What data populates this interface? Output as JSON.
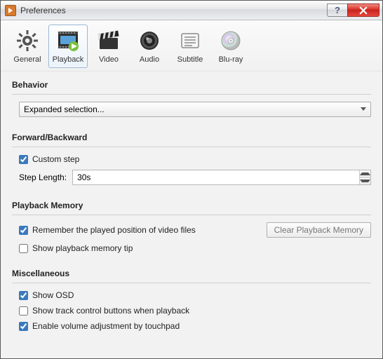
{
  "window": {
    "title": "Preferences"
  },
  "tabs": {
    "general": "General",
    "playback": "Playback",
    "video": "Video",
    "audio": "Audio",
    "subtitle": "Subtitle",
    "bluray": "Blu-ray"
  },
  "behavior": {
    "heading": "Behavior",
    "dropdown_value": "Expanded selection..."
  },
  "forward_backward": {
    "heading": "Forward/Backward",
    "custom_step_label": "Custom step",
    "custom_step_checked": true,
    "step_length_label": "Step Length:",
    "step_length_value": "30s"
  },
  "playback_memory": {
    "heading": "Playback Memory",
    "remember_label": "Remember the played position of video files",
    "remember_checked": true,
    "show_tip_label": "Show playback memory tip",
    "show_tip_checked": false,
    "clear_button": "Clear Playback Memory"
  },
  "misc": {
    "heading": "Miscellaneous",
    "show_osd_label": "Show OSD",
    "show_osd_checked": true,
    "track_buttons_label": "Show track control buttons when playback",
    "track_buttons_checked": false,
    "touchpad_label": "Enable volume adjustment by touchpad",
    "touchpad_checked": true
  }
}
